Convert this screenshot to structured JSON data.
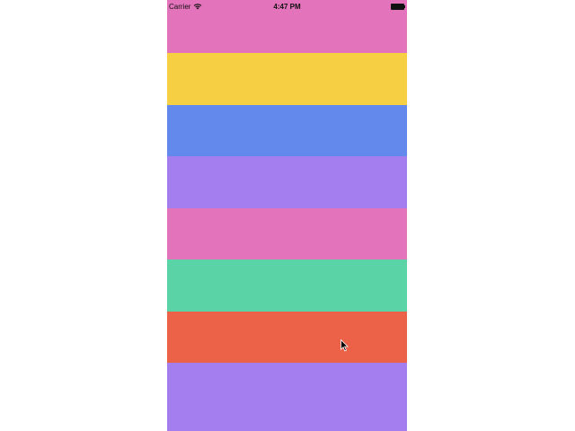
{
  "status_bar": {
    "carrier": "Carrier",
    "time": "4:47 PM",
    "wifi_icon": "wifi-icon",
    "battery_icon": "battery-full-icon"
  },
  "color_rows": [
    {
      "color": "#E373BA"
    },
    {
      "color": "#F6CF43"
    },
    {
      "color": "#6489EC"
    },
    {
      "color": "#A47DEE"
    },
    {
      "color": "#E373BA"
    },
    {
      "color": "#5AD4A7"
    },
    {
      "color": "#EB6249"
    },
    {
      "color": "#A47DEE"
    }
  ],
  "pointer": {
    "icon": "mouse-pointer-icon"
  }
}
